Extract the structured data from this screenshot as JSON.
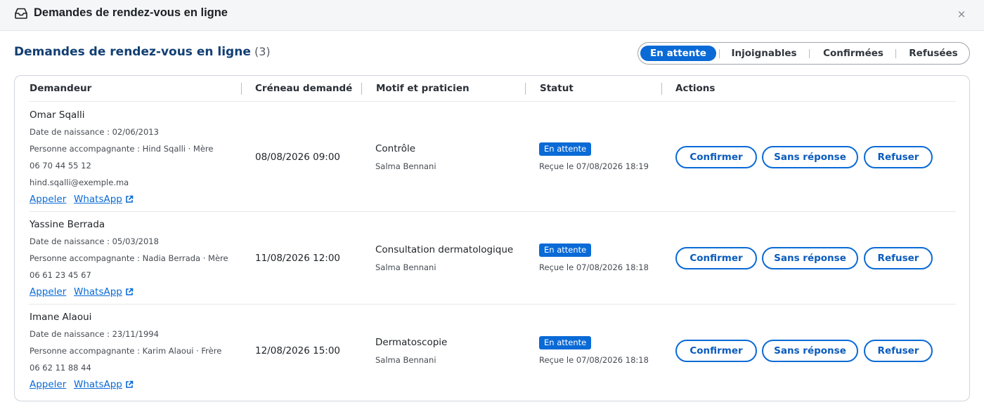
{
  "window": {
    "title": "Demandes de rendez-vous en ligne",
    "close_label": "×"
  },
  "page": {
    "title": "Demandes de rendez-vous en ligne",
    "count": "(3)"
  },
  "filters": [
    {
      "label": "En attente",
      "active": true
    },
    {
      "label": "Injoignables",
      "active": false
    },
    {
      "label": "Confirmées",
      "active": false
    },
    {
      "label": "Refusées",
      "active": false
    }
  ],
  "table": {
    "columns": [
      "Demandeur",
      "Créneau demandé",
      "Motif et praticien",
      "Statut",
      "Actions"
    ],
    "rows": [
      {
        "name": "Omar Sqalli",
        "details": [
          "Date de naissance : 02/06/2013",
          "Personne accompagnante : Hind Sqalli · Mère",
          "06 70 44 55 12",
          "hind.sqalli@exemple.ma"
        ],
        "call_label": "Appeler",
        "whatsapp_label": "WhatsApp",
        "slot": "08/08/2026 09:00",
        "motif": "Contrôle",
        "praticien": "Salma Bennani",
        "status": "En attente",
        "received": "Reçue le 07/08/2026 18:19",
        "actions": {
          "confirm": "Confirmer",
          "no_answer": "Sans réponse",
          "refuse": "Refuser"
        }
      },
      {
        "name": "Yassine Berrada",
        "details": [
          "Date de naissance : 05/03/2018",
          "Personne accompagnante : Nadia Berrada · Mère",
          "06 61 23 45 67"
        ],
        "call_label": "Appeler",
        "whatsapp_label": "WhatsApp",
        "slot": "11/08/2026 12:00",
        "motif": "Consultation dermatologique",
        "praticien": "Salma Bennani",
        "status": "En attente",
        "received": "Reçue le 07/08/2026 18:18",
        "actions": {
          "confirm": "Confirmer",
          "no_answer": "Sans réponse",
          "refuse": "Refuser"
        }
      },
      {
        "name": "Imane Alaoui",
        "details": [
          "Date de naissance : 23/11/1994",
          "Personne accompagnante : Karim Alaoui · Frère",
          "06 62 11 88 44"
        ],
        "call_label": "Appeler",
        "whatsapp_label": "WhatsApp",
        "slot": "12/08/2026 15:00",
        "motif": "Dermatoscopie",
        "praticien": "Salma Bennani",
        "status": "En attente",
        "received": "Reçue le 07/08/2026 18:18",
        "actions": {
          "confirm": "Confirmer",
          "no_answer": "Sans réponse",
          "refuse": "Refuser"
        }
      }
    ]
  },
  "colors": {
    "accent": "#0a6ad6",
    "heading": "#123f73"
  },
  "icons": {
    "window": "inbox-icon",
    "close": "close-icon",
    "external_link": "external-link-icon"
  }
}
